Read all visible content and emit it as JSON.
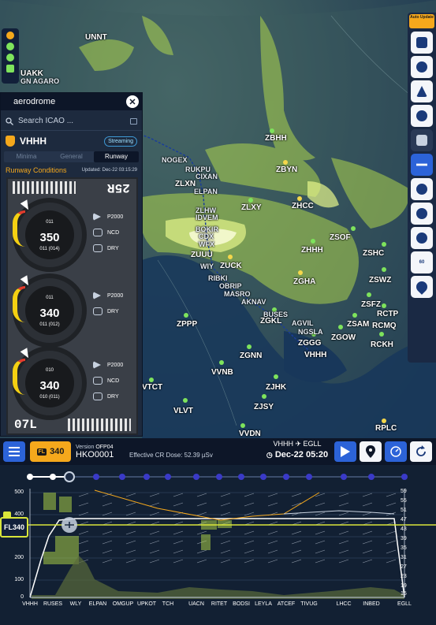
{
  "map": {
    "waypoints": [
      {
        "name": "UNNT",
        "small": false
      },
      {
        "name": "UAKK",
        "small": false
      },
      {
        "name": "GN AGARO",
        "small": true
      },
      {
        "name": "ZBHH",
        "small": false
      },
      {
        "name": "NOGEX",
        "small": true
      },
      {
        "name": "RUKPU",
        "small": true
      },
      {
        "name": "ZBYN",
        "small": false
      },
      {
        "name": "CIXAN",
        "small": true
      },
      {
        "name": "ZLXN",
        "small": false
      },
      {
        "name": "ELPAN",
        "small": true
      },
      {
        "name": "ZHCC",
        "small": false
      },
      {
        "name": "ZLXY",
        "small": false
      },
      {
        "name": "ZLHW",
        "small": true
      },
      {
        "name": "IDVEM",
        "small": true
      },
      {
        "name": "BOKIR",
        "small": true
      },
      {
        "name": "CDX",
        "small": true
      },
      {
        "name": "WFX",
        "small": true
      },
      {
        "name": "ZSOF",
        "small": false
      },
      {
        "name": "ZUUU",
        "small": false
      },
      {
        "name": "ZHHH",
        "small": false
      },
      {
        "name": "ZSHC",
        "small": false
      },
      {
        "name": "ZUCK",
        "small": false
      },
      {
        "name": "WIY",
        "small": true
      },
      {
        "name": "RIBKI",
        "small": true
      },
      {
        "name": "OBRIP",
        "small": true
      },
      {
        "name": "ZGHA",
        "small": false
      },
      {
        "name": "MASRO",
        "small": true
      },
      {
        "name": "ZSWZ",
        "small": false
      },
      {
        "name": "AKNAV",
        "small": true
      },
      {
        "name": "ZSFZ",
        "small": false
      },
      {
        "name": "RCTP",
        "small": false
      },
      {
        "name": "ZPPP",
        "small": false
      },
      {
        "name": "BUSES",
        "small": true
      },
      {
        "name": "ZGKL",
        "small": false
      },
      {
        "name": "AGVIL",
        "small": true
      },
      {
        "name": "ZSAM",
        "small": false
      },
      {
        "name": "RCMQ",
        "small": false
      },
      {
        "name": "NGSLA",
        "small": true
      },
      {
        "name": "ZGOW",
        "small": false
      },
      {
        "name": "ZGGG",
        "small": false
      },
      {
        "name": "VHHH",
        "small": false
      },
      {
        "name": "RCKH",
        "small": false
      },
      {
        "name": "ZGNN",
        "small": false
      },
      {
        "name": "VVNB",
        "small": false
      },
      {
        "name": "ZJHK",
        "small": false
      },
      {
        "name": "VTCT",
        "small": false
      },
      {
        "name": "ZJSY",
        "small": false
      },
      {
        "name": "VLVT",
        "small": false
      },
      {
        "name": "RPLC",
        "small": false
      },
      {
        "name": "VVDN",
        "small": false
      }
    ]
  },
  "aerodrome": {
    "title": "aerodrome",
    "search_placeholder": "Search ICAO ...",
    "icao": "VHHH",
    "streaming": "Streaming",
    "tabs": [
      "Minima",
      "General",
      "Runway"
    ],
    "active_tab": "Runway",
    "runway_conditions": "Runway Conditions",
    "updated": "Updated: Dec-22 03:15:29",
    "runway_top": "25R",
    "runway_bottom": "07L",
    "winds": [
      {
        "dir": "011",
        "speed": "350",
        "gust": "011 (014)",
        "rvr": "P2000",
        "cloud": "NCD",
        "state": "DRY"
      },
      {
        "dir": "011",
        "speed": "340",
        "gust": "011 (012)",
        "rvr": "P2000",
        "cloud": "",
        "state": "DRY"
      },
      {
        "dir": "010",
        "speed": "340",
        "gust": "010 (011)",
        "rvr": "P2000",
        "cloud": "NCD",
        "state": "DRY"
      }
    ]
  },
  "toolbar": {
    "auto_update": "Auto Update",
    "buttons": [
      "document-icon",
      "cloud-icon",
      "volcano-icon",
      "cyclone-icon",
      "turbulence-icon",
      "airplane-icon",
      "compass-icon",
      "radiation-icon",
      "target-icon",
      "layers-icon",
      "location-icon"
    ],
    "layers_label": "60"
  },
  "infobar": {
    "fl_label": "FL",
    "fl_value": "340",
    "version_label": "Version",
    "version": "OFP04",
    "flight": "HKO0001",
    "dose": "Effective CR Dose: 52.39 µSv",
    "origin": "VHHH",
    "destination": "EGLL",
    "datetime": "Dec-22 05:20"
  },
  "profile": {
    "y_ticks": [
      "500",
      "400",
      "300",
      "200",
      "100",
      "0"
    ],
    "right_ticks": [
      "59",
      "55",
      "51",
      "47",
      "43",
      "39",
      "35",
      "31",
      "27",
      "23",
      "19",
      "15"
    ],
    "fl_tag": "FL340",
    "waypoints": [
      "VHHH",
      "RUSES",
      "WLY",
      "ELPAN",
      "OMGUP",
      "UPKOT",
      "TCH",
      "UACN",
      "RITET",
      "BODSI",
      "LEYLA",
      "ATCEF",
      "TIVUG",
      "LHCC",
      "INBED",
      "EGLL"
    ]
  },
  "colors": {
    "accent": "#2c63d8",
    "orange": "#f5a81c",
    "turbulence": "#c8f04a",
    "panel": "#1d2a3e"
  }
}
